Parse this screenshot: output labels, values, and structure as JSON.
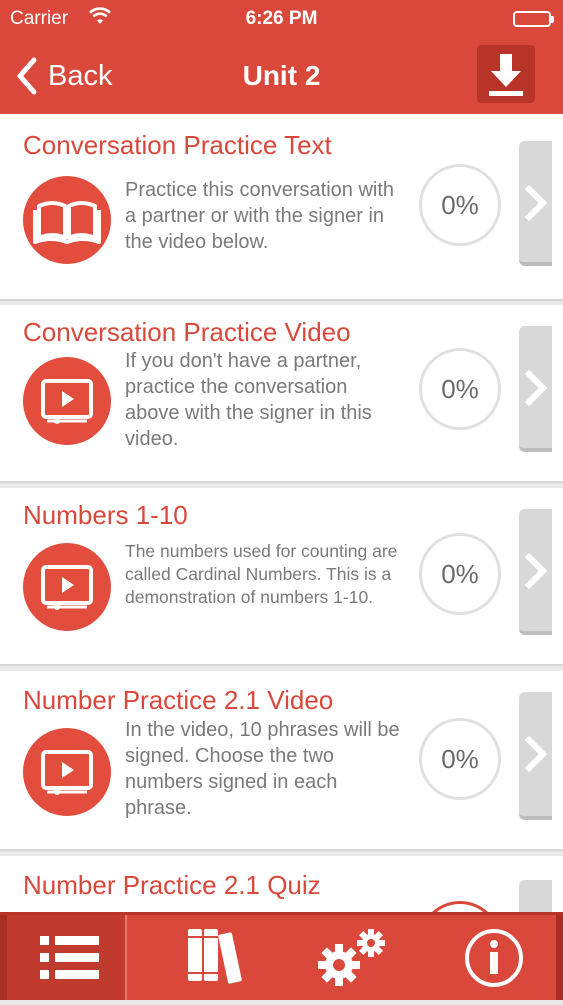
{
  "status_bar": {
    "carrier": "Carrier",
    "time": "6:26 PM"
  },
  "nav": {
    "back_label": "Back",
    "title": "Unit 2",
    "download_icon": "download-icon"
  },
  "lessons": [
    {
      "title": "Conversation Practice Text",
      "icon": "book-icon",
      "description": "Practice this conversation with a partner or with the signer in the video below.",
      "progress": "0%"
    },
    {
      "title": "Conversation Practice Video",
      "icon": "video-icon",
      "description": "If you don't have a partner, practice the conversation above with the signer in this video.",
      "progress": "0%"
    },
    {
      "title": "Numbers 1-10",
      "icon": "video-icon",
      "description": "The numbers used for counting are called Cardinal Numbers. This is a demonstration of numbers 1-10.",
      "progress": "0%"
    },
    {
      "title": "Number Practice 2.1 Video",
      "icon": "video-icon",
      "description": "In the video, 10 phrases will be signed. Choose the two numbers signed in each phrase.",
      "progress": "0%"
    },
    {
      "title": "Number Practice 2.1 Quiz",
      "icon": "quiz-icon",
      "description": "",
      "progress": ""
    }
  ],
  "tabbar": {
    "tabs": [
      "list-icon",
      "books-icon",
      "gears-icon",
      "info-icon"
    ],
    "active": "list-icon"
  },
  "colors": {
    "accent": "#d9483b",
    "accent_dark": "#b93428",
    "text_gray": "#7a7a7a"
  }
}
